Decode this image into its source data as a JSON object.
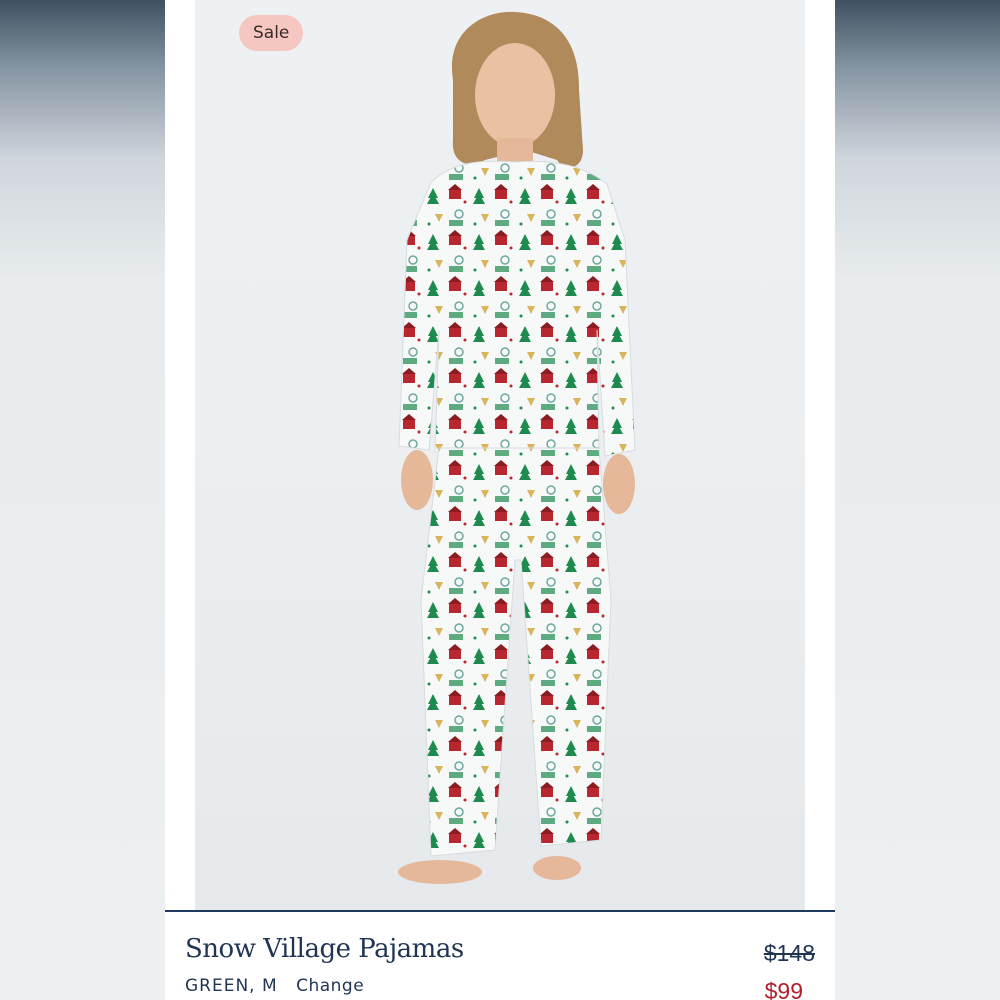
{
  "badge": {
    "label": "Sale"
  },
  "product": {
    "title": "Snow Village Pajamas",
    "color": "GREEN,",
    "size": "M",
    "change_label": "Change",
    "price_original": "$148",
    "price_sale": "$99"
  },
  "colors": {
    "badge_bg": "#f6c7c0",
    "navy": "#1f3552",
    "sale_red": "#b3202c",
    "print_green": "#1e8a4e",
    "print_red": "#b8262f"
  },
  "icons": {
    "photo": "pajama-model-photo"
  }
}
